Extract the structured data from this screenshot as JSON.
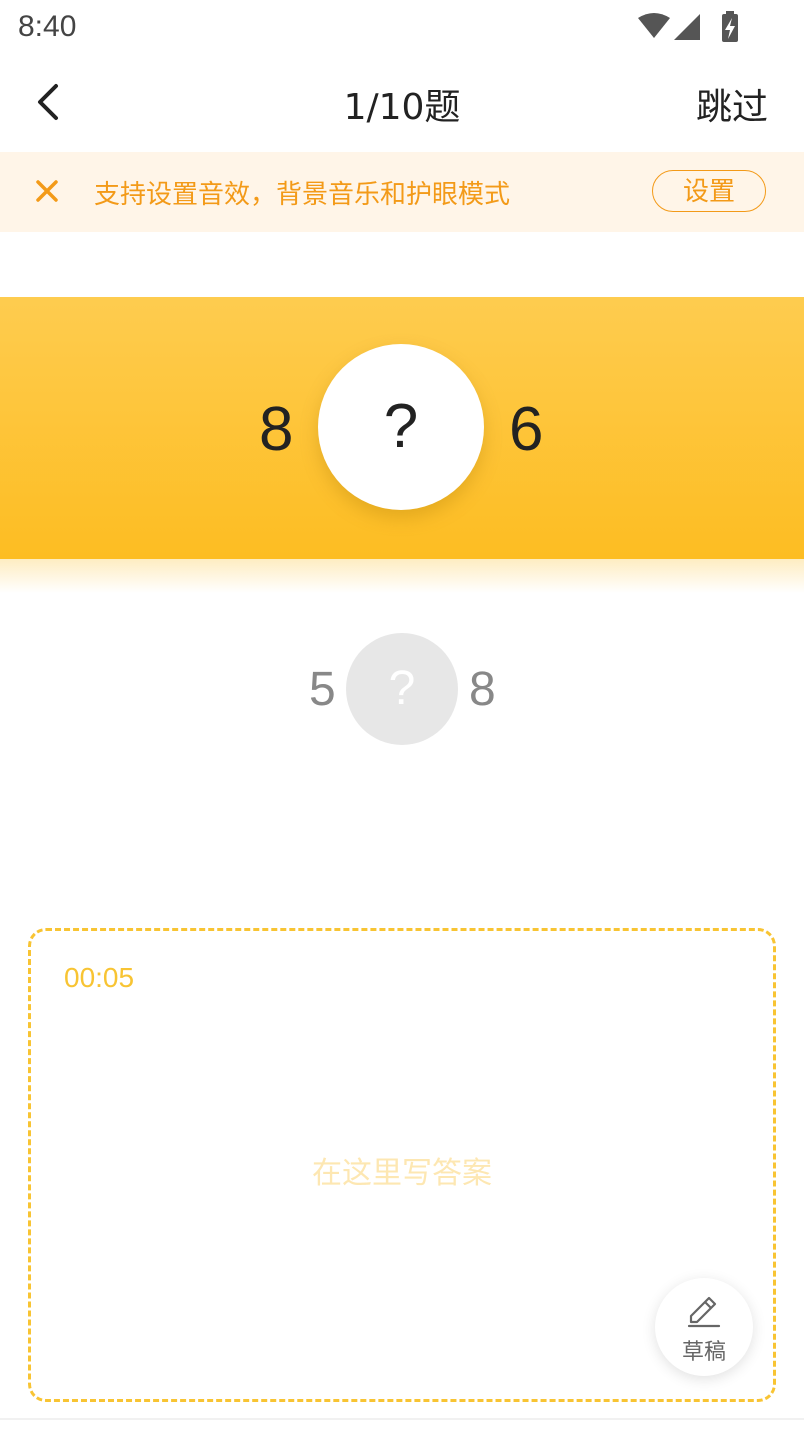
{
  "status_bar": {
    "time": "8:40"
  },
  "header": {
    "title": "1/10题",
    "skip_label": "跳过"
  },
  "banner": {
    "text": "支持设置音效，背景音乐和护眼模式",
    "button_label": "设置"
  },
  "current_question": {
    "left": "8",
    "blank": "?",
    "right": "6"
  },
  "next_question": {
    "left": "5",
    "blank": "?",
    "right": "8"
  },
  "answer_area": {
    "timer": "00:05",
    "placeholder": "在这里写答案"
  },
  "draft_button": {
    "label": "草稿"
  },
  "colors": {
    "accent_orange": "#f39a18",
    "accent_yellow": "#fdbd22",
    "dash_yellow": "#f8c433"
  },
  "icons": [
    "back-arrow-icon",
    "wifi-icon",
    "signal-icon",
    "battery-charging-icon",
    "close-icon",
    "pencil-icon"
  ]
}
